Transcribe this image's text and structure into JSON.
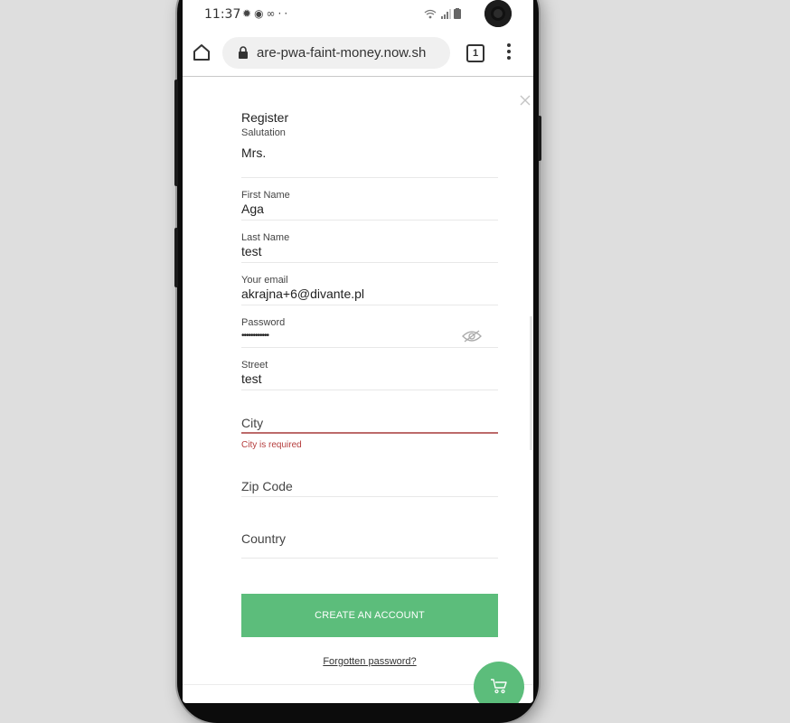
{
  "status_bar": {
    "time": "11:37",
    "icons": [
      "android-icon",
      "firefox-icon",
      "link-icon",
      "more-dots-icon"
    ],
    "signal_icons": [
      "wifi-icon",
      "signal-icon",
      "battery-icon"
    ]
  },
  "browser": {
    "url": "are-pwa-faint-money.now.sh",
    "tab_count": "1"
  },
  "form": {
    "title": "Register",
    "salutation_label": "Salutation",
    "salutation_value": "Mrs.",
    "first_name_label": "First Name",
    "first_name_value": "Aga",
    "last_name_label": "Last Name",
    "last_name_value": "test",
    "email_label": "Your email",
    "email_value": "akrajna+6@divante.pl",
    "password_label": "Password",
    "password_value": "••••••••••••",
    "street_label": "Street",
    "street_value": "test",
    "city_placeholder": "City",
    "city_error": "City is required",
    "zip_placeholder": "Zip Code",
    "country_placeholder": "Country",
    "create_button": "CREATE AN ACCOUNT",
    "forgot_link": "Forgotten password?"
  },
  "colors": {
    "accent": "#5cbd7b",
    "error": "#b53c3c",
    "background": "#dedede"
  }
}
